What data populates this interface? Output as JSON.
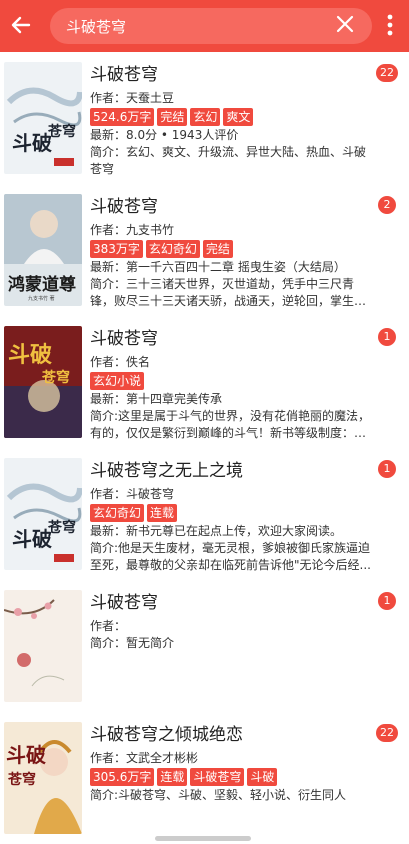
{
  "header": {
    "search_value": "斗破苍穹",
    "back_icon": "arrow-left-icon",
    "clear_icon": "close-icon",
    "more_icon": "more-vertical-icon",
    "bar_color": "#f04a3e"
  },
  "results": [
    {
      "title": "斗破苍穹",
      "author": "作者：天蚕土豆",
      "tags": [
        "524.6万字",
        "完结",
        "玄幻",
        "爽文"
      ],
      "latest": "最新：8.0分 • 1943人评价",
      "intro": "简介：玄幻、爽文、升级流、异世大陆、热血、斗破苍穹",
      "badge": "22",
      "cover_icon": "book-cover-ink-calligraphy"
    },
    {
      "title": "斗破苍穹",
      "author": "作者：九支书竹",
      "tags": [
        "383万字",
        "玄幻奇幻",
        "完结"
      ],
      "latest": "最新：第一千六百四十二章 摇曳生姿（大结局）",
      "intro": "简介：三十三诸天世界，灭世道劫，凭手中三尺青锋，败尽三十三天诸天骄，战通天，逆轮回，掌生死，踏...",
      "badge": "2",
      "cover_icon": "book-cover-hero-portrait"
    },
    {
      "title": "斗破苍穹",
      "author": "作者：佚名",
      "tags": [
        "玄幻小说"
      ],
      "latest": "最新：第十四章完美传承",
      "intro": "简介:这里是属于斗气的世界，没有花俏艳丽的魔法，有的，仅仅是繁衍到巅峰的斗气！新书等级制度：斗...",
      "badge": "1",
      "cover_icon": "book-cover-red-poster"
    },
    {
      "title": "斗破苍穹之无上之境",
      "author": "作者：斗破苍穹",
      "tags": [
        "玄幻奇幻",
        "连载"
      ],
      "latest": "最新：新书元尊已在起点上传，欢迎大家阅读。",
      "intro": "简介:他是天生废材，毫无灵根，爹娘被御氏家族逼迫至死，最尊敬的父亲却在临死前告诉他\"无论今后经...",
      "badge": "1",
      "cover_icon": "book-cover-ink-calligraphy"
    },
    {
      "title": "斗破苍穹",
      "author": "作者：",
      "tags": [],
      "latest": "",
      "intro": "简介：暂无简介",
      "badge": "1",
      "cover_icon": "book-cover-blossom-default"
    },
    {
      "title": "斗破苍穹之倾城绝恋",
      "author": "作者：文武全才彬彬",
      "tags": [
        "305.6万字",
        "连载",
        "斗破苍穹",
        "斗破"
      ],
      "latest": "",
      "intro": "简介:斗破苍穹、斗破、坚毅、轻小说、衍生同人",
      "badge": "22",
      "cover_icon": "book-cover-anime-girl"
    }
  ]
}
